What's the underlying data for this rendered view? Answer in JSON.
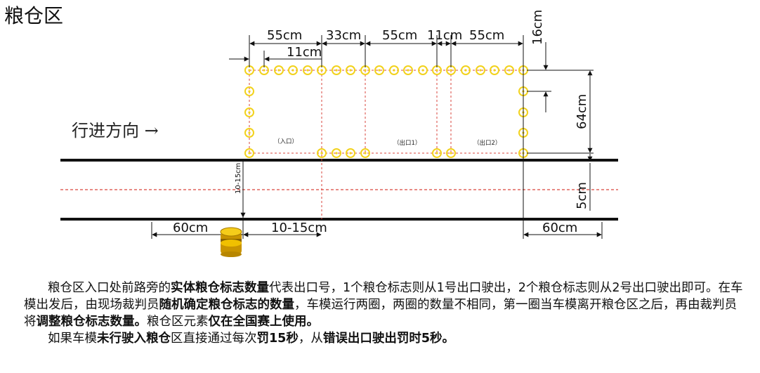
{
  "title": "粮仓区",
  "direction_label": "行进方向 →",
  "dimensions": {
    "top_55a": "55cm",
    "top_33": "33cm",
    "top_55b": "55cm",
    "top_11b": "11cm",
    "top_55c": "55cm",
    "top_11a": "11cm",
    "right_16": "16cm",
    "right_64": "64cm",
    "right_5": "5cm",
    "left_vertical": "10-15cm",
    "bottom_60a": "60cm",
    "bottom_1015": "10-15cm",
    "bottom_60b": "60cm"
  },
  "labels": {
    "entrance": "（入口）",
    "exit1": "（出口1）",
    "exit2": "（出口2）"
  },
  "colors": {
    "marker_yellow": "#f2d21c",
    "dashed_red": "#d9463c",
    "road": "#111111",
    "icon_gold": "#e8b400"
  },
  "description": {
    "p1_a": "粮仓区入口处前路旁的",
    "p1_b": "实体粮仓标志数量",
    "p1_c": "代表出口号，1个粮仓标志则从1号出口驶出，2个粮仓标志则从2号出口驶出即可。在车模出发后，由现场裁判员",
    "p1_d": "随机确定粮仓标志的数量",
    "p1_e": "，车模运行两圈，两圈的数量不相同，第一圈当车模离开粮仓区之后，再由裁判员将",
    "p1_f": "调整粮仓标志数量。",
    "p1_g": "粮仓区元素",
    "p1_h": "仅在全国赛上使用。",
    "p2_a": "如果车模",
    "p2_b": "未行驶入粮仓",
    "p2_c": "区直接通过每次",
    "p2_d": "罚15秒",
    "p2_e": "，从",
    "p2_f": "错误出口驶出罚时5秒。"
  }
}
